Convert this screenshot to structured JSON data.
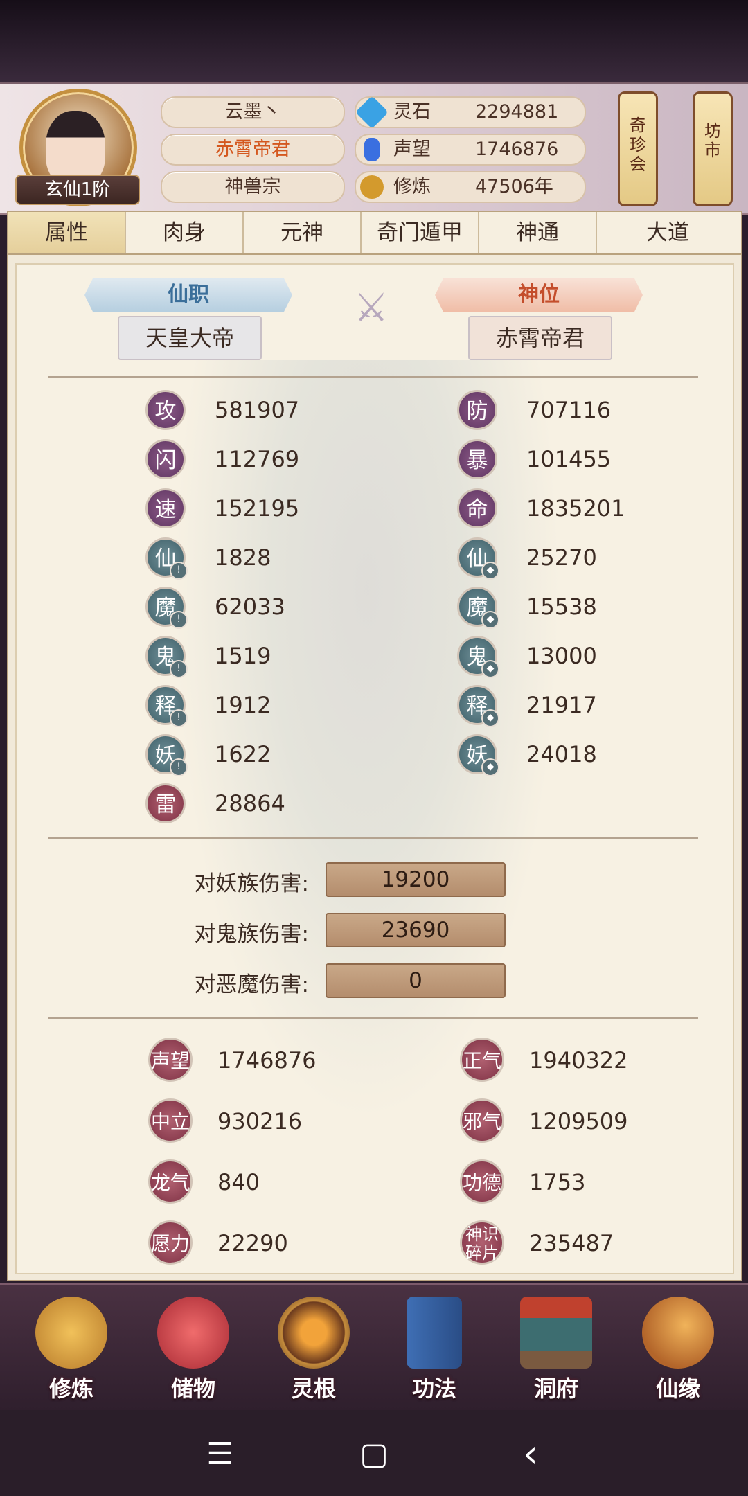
{
  "player": {
    "name": "云墨丶",
    "title": "赤霄帝君",
    "sect": "神兽宗",
    "rank": "玄仙1阶"
  },
  "resources": [
    {
      "label": "灵石",
      "value": "2294881",
      "icon": "spirit-stone-icon",
      "color": "#3aa2e4"
    },
    {
      "label": "声望",
      "value": "1746876",
      "icon": "reputation-crystal-icon",
      "color": "#3a6fe0"
    },
    {
      "label": "修炼",
      "value": "47506年",
      "icon": "meditation-icon",
      "color": "#d39a2d"
    }
  ],
  "side_buttons": {
    "treasure": [
      "奇",
      "珍",
      "会"
    ],
    "market": [
      "坊",
      "市"
    ]
  },
  "tabs": [
    "属性",
    "肉身",
    "元神",
    "奇门遁甲",
    "神通",
    "大道"
  ],
  "positions": {
    "xianzhi_label": "仙职",
    "xianzhi_value": "天皇大帝",
    "shenwei_label": "神位",
    "shenwei_value": "赤霄帝君"
  },
  "stats_left": [
    {
      "char": "攻",
      "value": "581907",
      "style": "purple"
    },
    {
      "char": "闪",
      "value": "112769",
      "style": "purple"
    },
    {
      "char": "速",
      "value": "152195",
      "style": "purple"
    },
    {
      "char": "仙",
      "value": "1828",
      "style": "teal"
    },
    {
      "char": "魔",
      "value": "62033",
      "style": "teal"
    },
    {
      "char": "鬼",
      "value": "1519",
      "style": "teal"
    },
    {
      "char": "释",
      "value": "1912",
      "style": "teal"
    },
    {
      "char": "妖",
      "value": "1622",
      "style": "teal"
    },
    {
      "char": "雷",
      "value": "28864",
      "style": "red"
    }
  ],
  "stats_right": [
    {
      "char": "防",
      "value": "707116",
      "style": "purple"
    },
    {
      "char": "暴",
      "value": "101455",
      "style": "purple"
    },
    {
      "char": "命",
      "value": "1835201",
      "style": "purple"
    },
    {
      "char": "仙",
      "value": "25270",
      "style": "teal"
    },
    {
      "char": "魔",
      "value": "15538",
      "style": "teal"
    },
    {
      "char": "鬼",
      "value": "13000",
      "style": "teal"
    },
    {
      "char": "释",
      "value": "21917",
      "style": "teal"
    },
    {
      "char": "妖",
      "value": "24018",
      "style": "teal"
    }
  ],
  "damage": [
    {
      "label": "对妖族伤害:",
      "value": "19200"
    },
    {
      "label": "对鬼族伤害:",
      "value": "23690"
    },
    {
      "label": "对恶魔伤害:",
      "value": "0"
    }
  ],
  "reputation_left": [
    {
      "char": "声望",
      "value": "1746876"
    },
    {
      "char": "中立",
      "value": "930216"
    },
    {
      "char": "龙气",
      "value": "840"
    },
    {
      "char": "愿力",
      "value": "22290"
    }
  ],
  "reputation_right": [
    {
      "char": "正气",
      "value": "1940322"
    },
    {
      "char": "邪气",
      "value": "1209509"
    },
    {
      "char": "功德",
      "value": "1753"
    },
    {
      "char": "神识碎片",
      "value": "235487"
    }
  ],
  "bottom_nav": [
    {
      "label": "修炼",
      "icon": "cultivate-monk-icon"
    },
    {
      "label": "储物",
      "icon": "storage-bag-icon"
    },
    {
      "label": "灵根",
      "icon": "spirit-root-icon"
    },
    {
      "label": "功法",
      "icon": "scripture-book-icon"
    },
    {
      "label": "洞府",
      "icon": "cave-residence-icon"
    },
    {
      "label": "仙缘",
      "icon": "gourd-icon"
    }
  ],
  "system_nav": [
    "☰",
    "▢",
    "‹"
  ]
}
